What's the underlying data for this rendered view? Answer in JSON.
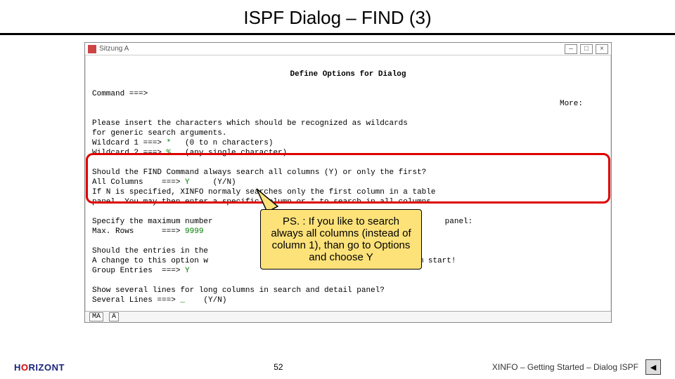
{
  "slide": {
    "title": "ISPF Dialog – FIND (3)",
    "page_number": "52",
    "doc_label": "XINFO – Getting Started – Dialog ISPF"
  },
  "brand": {
    "part1": "H",
    "part2": "O",
    "part3": "RIZONT"
  },
  "window": {
    "title": "Sitzung A",
    "minimize": "–",
    "maximize": "□",
    "close": "×"
  },
  "terminal": {
    "heading": "Define Options for Dialog",
    "command_label": "Command ===>",
    "more_label": "More:",
    "wild_intro1": "Please insert the characters which should be recognized as wildcards",
    "wild_intro2": "for generic search arguments.",
    "wild1_label": "Wildcard 1 ===> ",
    "wild1_value": "*",
    "wild1_desc": "   (0 to n characters)",
    "wild2_label": "Wildcard 2 ===> ",
    "wild2_value": "%",
    "wild2_desc": "   (any single character)",
    "find_q": "Should the FIND Command always search all columns (Y) or only the first?",
    "allcols_label": "All Columns    ===> ",
    "allcols_value": "Y",
    "allcols_desc": "     (Y/N)",
    "find_note1": "If N is specified, XINFO normaly searches only the first column in a table",
    "find_note2": "panel. You may then enter a specific column or * to search in all columns.",
    "maxrows_intro": "Specify the maximum number",
    "maxrows_suffix": "panel:",
    "maxrows_label": "Max. Rows      ===> ",
    "maxrows_value": "9999",
    "group_q1": "Should the entries in the",
    "group_q2": "A change to this option w",
    "group_q2_suffix": "program start!",
    "group_label": "Group Entries  ===> ",
    "group_value": "Y",
    "sev_q": "Show several lines for long columns in search and detail panel?",
    "sev_label": "Several Lines ===> ",
    "sev_value": "_",
    "sev_desc": "    (Y/N)",
    "status_ma": "MA",
    "status_a": "A"
  },
  "callout": {
    "text": "PS. : If you like to search always all columns (instead of column 1), than go to Options and choose Y"
  },
  "nav": {
    "back_glyph": "◄"
  }
}
